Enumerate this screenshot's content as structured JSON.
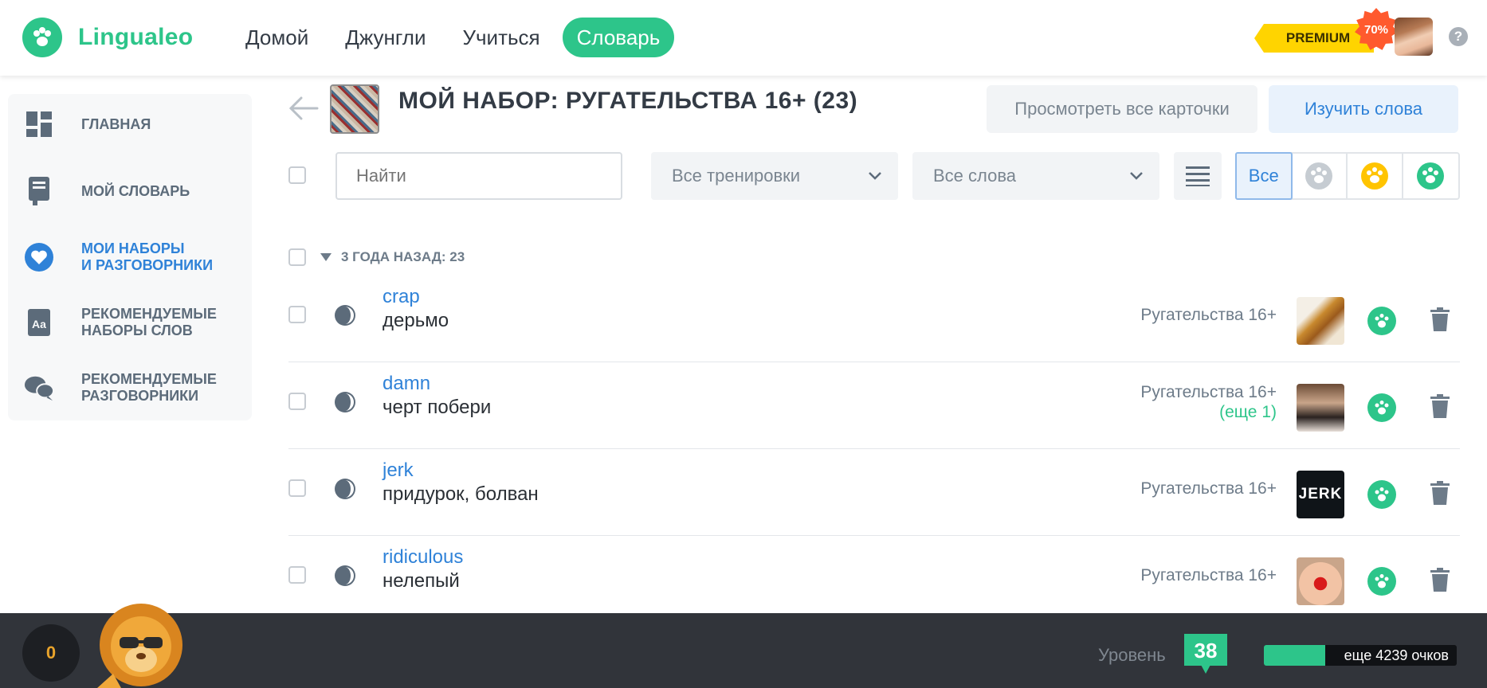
{
  "header": {
    "logo_text": "Lingualeo",
    "nav": [
      {
        "label": "Домой"
      },
      {
        "label": "Джунгли"
      },
      {
        "label": "Учиться"
      },
      {
        "label": "Словарь",
        "active": true
      }
    ],
    "premium_label": "PREMIUM",
    "discount_label": "70%",
    "help_label": "?"
  },
  "sidebar": {
    "items": [
      {
        "label_line1": "ГЛАВНАЯ",
        "label_line2": ""
      },
      {
        "label_line1": "МОЙ СЛОВАРЬ",
        "label_line2": ""
      },
      {
        "label_line1": "МОИ НАБОРЫ",
        "label_line2": "И РАЗГОВОРНИКИ",
        "active": true
      },
      {
        "label_line1": "РЕКОМЕНДУЕМЫЕ",
        "label_line2": "НАБОРЫ СЛОВ"
      },
      {
        "label_line1": "РЕКОМЕНДУЕМЫЕ",
        "label_line2": "РАЗГОВОРНИКИ"
      }
    ]
  },
  "main": {
    "title": "МОЙ НАБОР: РУГАТЕЛЬСТВА 16+ (23)",
    "view_cards_label": "Просмотреть все карточки",
    "learn_words_label": "Изучить слова",
    "search_placeholder": "Найти",
    "filter_trainings": "Все тренировки",
    "filter_words": "Все слова",
    "segment_all_label": "Все",
    "group_label": "3 ГОДА НАЗАД: 23",
    "words": [
      {
        "en": "crap",
        "ru": "дерьмо",
        "set": "Ругательства 16+",
        "more": ""
      },
      {
        "en": "damn",
        "ru": "черт побери",
        "set": "Ругательства 16+",
        "more": "(еще 1)"
      },
      {
        "en": "jerk",
        "ru": "придурок, болван",
        "set": "Ругательства 16+",
        "more": ""
      },
      {
        "en": "ridiculous",
        "ru": "нелепый",
        "set": "Ругательства 16+",
        "more": ""
      }
    ],
    "image_labels": {
      "jerk": "JERK"
    }
  },
  "bottom": {
    "coins": "0",
    "level_label": "Уровень",
    "level_value": "38",
    "xp_text": "еще 4239 очков",
    "xp_progress": 0.32
  },
  "colors": {
    "brand_green": "#2dc58a",
    "link_blue": "#2f82d8",
    "premium_yellow": "#ffd400",
    "discount_orange": "#ff5a2e",
    "bottom_bar": "#31343a"
  },
  "icons": {
    "logo": "paw-icon",
    "sidebar": [
      "dashboard-icon",
      "dictionary-book-icon",
      "heart-icon",
      "phrasebook-icon",
      "chat-bubbles-icon"
    ],
    "row_progress": "half-moon-progress-icon",
    "row_action": "paw-icon",
    "row_delete": "trash-icon"
  }
}
